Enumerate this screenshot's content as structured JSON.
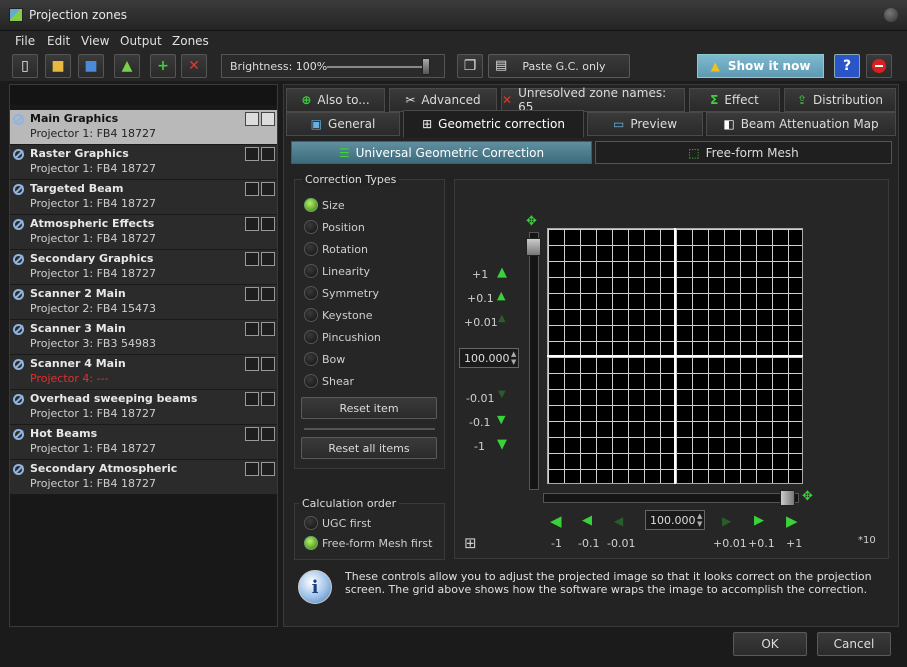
{
  "window": {
    "title": "Projection zones"
  },
  "menu": [
    "File",
    "Edit",
    "View",
    "Output",
    "Zones"
  ],
  "toolbar": {
    "brightness_label": "Brightness: 100%",
    "paste_label": "Paste G.C. only",
    "show_label": "Show it now",
    "help_icon": "help-icon",
    "stop_icon": "stop-icon"
  },
  "zones": [
    {
      "name": "Main Graphics",
      "projector": "Projector 1: FB4 18727",
      "selected": true
    },
    {
      "name": "Raster Graphics",
      "projector": "Projector 1: FB4 18727"
    },
    {
      "name": "Targeted Beam",
      "projector": "Projector 1: FB4 18727"
    },
    {
      "name": "Atmospheric Effects",
      "projector": "Projector 1: FB4 18727"
    },
    {
      "name": "Secondary Graphics",
      "projector": "Projector 1: FB4 18727"
    },
    {
      "name": "Scanner 2 Main",
      "projector": "Projector 2: FB4 15473"
    },
    {
      "name": "Scanner 3 Main",
      "projector": "Projector 3: FB3 54983"
    },
    {
      "name": "Scanner 4 Main",
      "projector": "Projector 4: ---",
      "warning": true
    },
    {
      "name": "Overhead sweeping beams",
      "projector": "Projector 1: FB4 18727"
    },
    {
      "name": "Hot Beams",
      "projector": "Projector 1: FB4 18727"
    },
    {
      "name": "Secondary Atmospheric",
      "projector": "Projector 1: FB4 18727"
    }
  ],
  "tabs_row1": [
    "Also to...",
    "Advanced",
    "Unresolved zone names: 65",
    "Effect",
    "Distribution"
  ],
  "tabs_row2": [
    "General",
    "Geometric correction",
    "Preview",
    "Beam Attenuation Map"
  ],
  "subtabs": [
    "Universal Geometric Correction",
    "Free-form Mesh"
  ],
  "correction": {
    "title": "Correction Types",
    "types": [
      "Size",
      "Position",
      "Rotation",
      "Linearity",
      "Symmetry",
      "Keystone",
      "Pincushion",
      "Bow",
      "Shear"
    ],
    "selected": "Size",
    "reset_item": "Reset item",
    "reset_all": "Reset all items"
  },
  "calc": {
    "title": "Calculation order",
    "options": [
      "UGC first",
      "Free-form Mesh first"
    ],
    "selected": "Free-form Mesh first"
  },
  "vertical_steps": [
    "+1",
    "+0.1",
    "+0.01",
    "-0.01",
    "-0.1",
    "-1"
  ],
  "horizontal_steps": [
    "-1",
    "-0.1",
    "-0.01",
    "+0.01",
    "+0.1",
    "+1"
  ],
  "vertical_value": "100.000",
  "horizontal_value": "100.000",
  "scale_label": "*10",
  "info_text": "These controls allow you to adjust the projected image so that it looks correct on the projection screen. The grid above shows how the software wraps the image to accomplish the correction.",
  "buttons": {
    "ok": "OK",
    "cancel": "Cancel"
  }
}
